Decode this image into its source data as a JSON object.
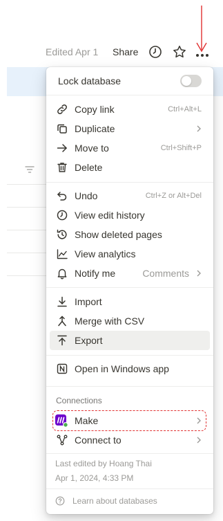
{
  "topbar": {
    "edited": "Edited Apr 1",
    "share": "Share",
    "icons": [
      "clock-icon",
      "star-icon",
      "more-icon"
    ]
  },
  "annotation_color": "#e03131",
  "menu": {
    "lock": {
      "label": "Lock database",
      "toggle_on": false
    },
    "items": {
      "copy_link": {
        "label": "Copy link",
        "shortcut": "Ctrl+Alt+L",
        "icon": "link-icon"
      },
      "duplicate": {
        "label": "Duplicate",
        "icon": "duplicate-icon"
      },
      "move_to": {
        "label": "Move to",
        "shortcut": "Ctrl+Shift+P",
        "icon": "arrow-right-icon"
      },
      "delete": {
        "label": "Delete",
        "icon": "trash-icon"
      },
      "undo": {
        "label": "Undo",
        "shortcut": "Ctrl+Z or Alt+Del",
        "icon": "undo-icon"
      },
      "edit_history": {
        "label": "View edit history",
        "icon": "clock-icon"
      },
      "deleted_pages": {
        "label": "Show deleted pages",
        "icon": "restore-icon"
      },
      "analytics": {
        "label": "View analytics",
        "icon": "chart-icon"
      },
      "notify": {
        "label": "Notify me",
        "value": "Comments",
        "icon": "bell-icon"
      },
      "import": {
        "label": "Import",
        "icon": "import-icon"
      },
      "merge_csv": {
        "label": "Merge with CSV",
        "icon": "merge-icon"
      },
      "export": {
        "label": "Export",
        "icon": "export-icon"
      },
      "open_windows": {
        "label": "Open in Windows app",
        "icon": "notion-icon"
      }
    },
    "connections": {
      "title": "Connections",
      "make": {
        "label": "Make",
        "icon": "make-logo-icon",
        "brand_color": "#6d00cc"
      },
      "connect_to": {
        "label": "Connect to",
        "icon": "connect-icon"
      }
    },
    "footer": {
      "last_edited_by": "Last edited by Hoang Thai",
      "last_edited_at": "Apr 1, 2024, 4:33 PM",
      "learn": "Learn about databases"
    }
  }
}
